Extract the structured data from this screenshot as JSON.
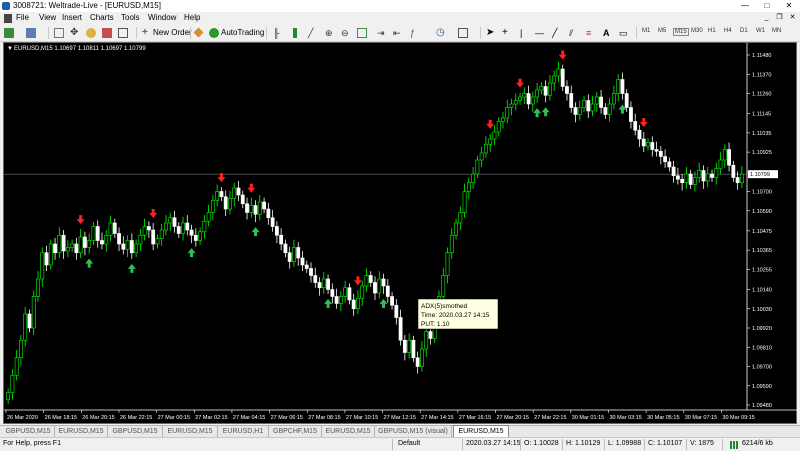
{
  "window": {
    "title": "3008721: Weltrade-Live - [EURUSD,M15]",
    "minimize": "—",
    "maximize": "□",
    "close": "✕"
  },
  "menu": [
    "File",
    "View",
    "Insert",
    "Charts",
    "Tools",
    "Window",
    "Help"
  ],
  "toolbar": {
    "new_order": "New Order",
    "autotrading": "AutoTrading",
    "timeframes": [
      "M1",
      "M5",
      "M15",
      "M30",
      "H1",
      "H4",
      "D1",
      "W1",
      "MN"
    ],
    "active_timeframe": "M15"
  },
  "chart": {
    "header": "EURUSD,M15  1.10697 1.10811 1.10697 1.10799",
    "current_price": "1.10799",
    "colors": {
      "background": "#000000",
      "bull": "#00ff00",
      "bear": "#ffffff",
      "up_arrow": "#2fbf5a",
      "down_arrow": "#ff2020",
      "grid_price_line": "#7a7a7a"
    },
    "price_ticks": [
      "1.11480",
      "1.11370",
      "1.11260",
      "1.11145",
      "1.11035",
      "1.10925",
      "1.10810",
      "1.10700",
      "1.10590",
      "1.10475",
      "1.10365",
      "1.10255",
      "1.10140",
      "1.10030",
      "1.09920",
      "1.09810",
      "1.09700",
      "1.09590",
      "1.09480"
    ],
    "time_ticks": [
      "26 Mar 2020",
      "26 Mar 18:15",
      "26 Mar 20:15",
      "26 Mar 22:15",
      "27 Mar 00:15",
      "27 Mar 02:15",
      "27 Mar 04:15",
      "27 Mar 06:15",
      "27 Mar 08:15",
      "27 Mar 10:15",
      "27 Mar 12:15",
      "27 Mar 14:15",
      "27 Mar 16:15",
      "27 Mar 20:15",
      "27 Mar 22:15",
      "30 Mar 01:15",
      "30 Mar 03:15",
      "30 Mar 05:15",
      "30 Mar 07:15",
      "30 Mar 09:15"
    ],
    "tooltip": {
      "line1": "ADX(5)smothed",
      "line2": "Time: 2020.03.27 14:15",
      "line3": "PUT: 1.10"
    }
  },
  "chart_data": {
    "type": "candlestick",
    "symbol": "EURUSD",
    "timeframe": "M15",
    "ylim": [
      1.0948,
      1.1148
    ],
    "closes": [
      1.0955,
      1.0965,
      1.0975,
      1.0985,
      1.1,
      1.0992,
      1.101,
      1.102,
      1.1035,
      1.1028,
      1.104,
      1.1035,
      1.1045,
      1.1036,
      1.1038,
      1.104,
      1.1035,
      1.1044,
      1.1038,
      1.1042,
      1.105,
      1.1042,
      1.104,
      1.1045,
      1.1052,
      1.1046,
      1.104,
      1.1037,
      1.1042,
      1.1035,
      1.104,
      1.1045,
      1.105,
      1.1048,
      1.104,
      1.1043,
      1.1048,
      1.1052,
      1.1055,
      1.105,
      1.1046,
      1.1052,
      1.1048,
      1.1045,
      1.1042,
      1.1047,
      1.1053,
      1.1058,
      1.1065,
      1.107,
      1.1067,
      1.106,
      1.1066,
      1.1072,
      1.1068,
      1.1063,
      1.1058,
      1.1062,
      1.1057,
      1.1064,
      1.106,
      1.1055,
      1.105,
      1.1045,
      1.104,
      1.1035,
      1.103,
      1.1038,
      1.1032,
      1.1028,
      1.1026,
      1.1022,
      1.1018,
      1.1015,
      1.102,
      1.1014,
      1.101,
      1.1006,
      1.101,
      1.1015,
      1.1008,
      1.1003,
      1.1009,
      1.1016,
      1.1022,
      1.1018,
      1.1012,
      1.102,
      1.1016,
      1.101,
      1.1005,
      1.0998,
      1.0985,
      1.0978,
      1.0985,
      1.0975,
      1.097,
      1.098,
      1.099,
      1.0986,
      1.0998,
      1.101,
      1.1022,
      1.1035,
      1.1045,
      1.1052,
      1.1058,
      1.107,
      1.1075,
      1.108,
      1.1088,
      1.1092,
      1.1097,
      1.11,
      1.1104,
      1.111,
      1.1112,
      1.1118,
      1.112,
      1.1122,
      1.1124,
      1.1126,
      1.112,
      1.1124,
      1.1128,
      1.113,
      1.1125,
      1.1132,
      1.1136,
      1.114,
      1.113,
      1.1126,
      1.1118,
      1.1114,
      1.1118,
      1.1122,
      1.1116,
      1.112,
      1.1124,
      1.1118,
      1.1114,
      1.112,
      1.1126,
      1.1134,
      1.1126,
      1.1118,
      1.111,
      1.1105,
      1.11,
      1.1096,
      1.1098,
      1.1094,
      1.1093,
      1.109,
      1.1087,
      1.1084,
      1.1079,
      1.1077,
      1.1075,
      1.108,
      1.1074,
      1.1078,
      1.1082,
      1.1076,
      1.108,
      1.1078,
      1.1083,
      1.1088,
      1.1094,
      1.1085,
      1.1078,
      1.1075,
      1.108
    ],
    "down_arrows": [
      17,
      34,
      50,
      57,
      82,
      113,
      120,
      130,
      149
    ],
    "up_arrows": [
      19,
      29,
      43,
      58,
      75,
      88,
      124,
      126,
      144
    ]
  },
  "tabs": [
    "GBPUSD,M15",
    "EURUSD,M15",
    "GBPUSD,M15",
    "EURUSD,M15",
    "EURUSD,H1",
    "GBPCHF,M15",
    "EURUSD,M15",
    "GBPUSD,M15 (visual)",
    "EURUSD,M15"
  ],
  "active_tab": 8,
  "status": {
    "help": "For Help, press F1",
    "profile": "Default",
    "datetime": "2020.03.27 14:15",
    "open": "O: 1.10028",
    "high": "H: 1.10129",
    "low": "L: 1.09988",
    "close": "C: 1.10107",
    "volume": "V: 1875",
    "traffic": "6214/6 kb"
  }
}
